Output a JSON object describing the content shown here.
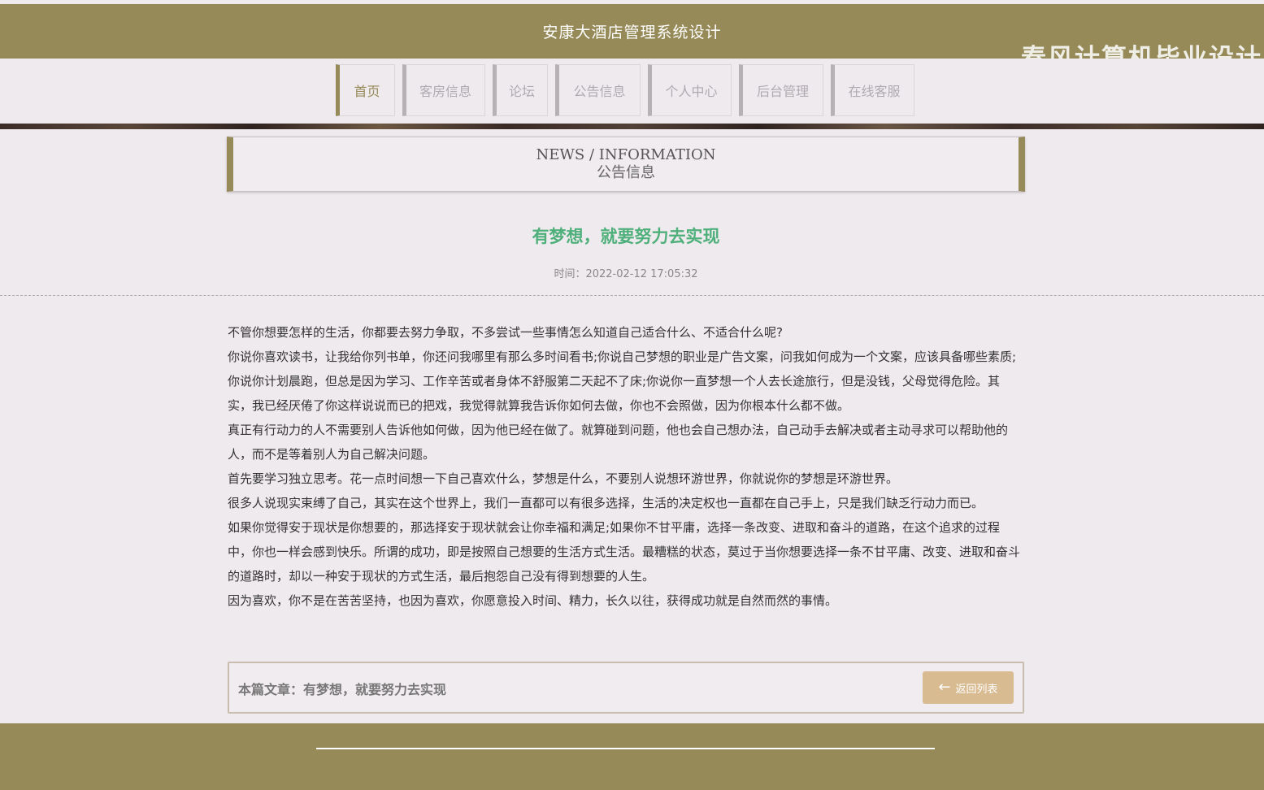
{
  "header": {
    "title": "安康大酒店管理系统设计",
    "watermark": "春风计算机毕业设计"
  },
  "nav": {
    "items": [
      {
        "label": "首页",
        "active": true
      },
      {
        "label": "客房信息",
        "active": false
      },
      {
        "label": "论坛",
        "active": false
      },
      {
        "label": "公告信息",
        "active": false
      },
      {
        "label": "个人中心",
        "active": false
      },
      {
        "label": "后台管理",
        "active": false
      },
      {
        "label": "在线客服",
        "active": false
      }
    ]
  },
  "section": {
    "title_en": "NEWS / INFORMATION",
    "title_cn": "公告信息"
  },
  "article": {
    "title": "有梦想，就要努力去实现",
    "time": "时间：2022-02-12 17:05:32",
    "paragraphs": [
      "不管你想要怎样的生活，你都要去努力争取，不多尝试一些事情怎么知道自己适合什么、不适合什么呢?",
      "你说你喜欢读书，让我给你列书单，你还问我哪里有那么多时间看书;你说自己梦想的职业是广告文案，问我如何成为一个文案，应该具备哪些素质;你说你计划晨跑，但总是因为学习、工作辛苦或者身体不舒服第二天起不了床;你说你一直梦想一个人去长途旅行，但是没钱，父母觉得危险。其实，我已经厌倦了你这样说说而已的把戏，我觉得就算我告诉你如何去做，你也不会照做，因为你根本什么都不做。",
      "真正有行动力的人不需要别人告诉他如何做，因为他已经在做了。就算碰到问题，他也会自己想办法，自己动手去解决或者主动寻求可以帮助他的人，而不是等着别人为自己解决问题。",
      "首先要学习独立思考。花一点时间想一下自己喜欢什么，梦想是什么，不要别人说想环游世界，你就说你的梦想是环游世界。",
      "很多人说现实束缚了自己，其实在这个世界上，我们一直都可以有很多选择，生活的决定权也一直都在自己手上，只是我们缺乏行动力而已。",
      "如果你觉得安于现状是你想要的，那选择安于现状就会让你幸福和满足;如果你不甘平庸，选择一条改变、进取和奋斗的道路，在这个追求的过程中，你也一样会感到快乐。所谓的成功，即是按照自己想要的生活方式生活。最糟糕的状态，莫过于当你想要选择一条不甘平庸、改变、进取和奋斗的道路时，却以一种安于现状的方式生活，最后抱怨自己没有得到想要的人生。",
      "因为喜欢，你不是在苦苦坚持，也因为喜欢，你愿意投入时间、精力，长久以往，获得成功就是自然而然的事情。"
    ]
  },
  "bottom": {
    "label": "本篇文章：有梦想，就要努力去实现",
    "back_label": "返回列表",
    "back_icon": "arrow-left-icon"
  },
  "colors": {
    "brand": "#968a58",
    "title_green": "#4fb07b",
    "button": "#d9bb92"
  }
}
